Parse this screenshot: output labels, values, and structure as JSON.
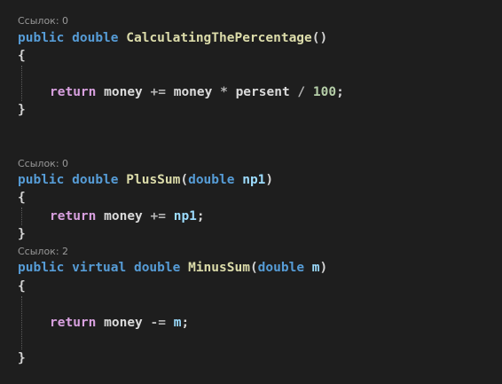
{
  "blocks": [
    {
      "references": "Ссылок: 0",
      "signature": {
        "modifiers": [
          "public",
          "double"
        ],
        "name": "CalculatingThePercentage",
        "params_open": "(",
        "params": [],
        "params_close": ")"
      },
      "open_brace": "{",
      "body": {
        "keyword": "return",
        "tokens": [
          "money",
          "+=",
          "money",
          "*",
          "persent",
          "/",
          "100",
          ";"
        ]
      },
      "close_brace": "}"
    },
    {
      "references": "Ссылок: 0",
      "signature": {
        "modifiers": [
          "public",
          "double"
        ],
        "name": "PlusSum",
        "params_open": "(",
        "param_type": "double",
        "param_name": "np1",
        "params_close": ")"
      },
      "open_brace": "{",
      "body": {
        "keyword": "return",
        "tokens": [
          "money",
          "+=",
          "np1",
          ";"
        ]
      },
      "close_brace": "}"
    },
    {
      "references": "Ссылок: 2",
      "signature": {
        "modifiers": [
          "public",
          "virtual",
          "double"
        ],
        "name": "MinusSum",
        "params_open": "(",
        "param_type": "double",
        "param_name": "m",
        "params_close": ")"
      },
      "open_brace": "{",
      "body": {
        "keyword": "return",
        "tokens": [
          "money",
          "-=",
          "m",
          ";"
        ]
      },
      "close_brace": "}"
    }
  ],
  "colors": {
    "background": "#1e1e1e",
    "keyword": "#569cd6",
    "control_keyword": "#d8a0df",
    "method_name": "#dcdcaa",
    "identifier": "#dadada",
    "parameter": "#9cdcfe",
    "number": "#b5cea8"
  }
}
